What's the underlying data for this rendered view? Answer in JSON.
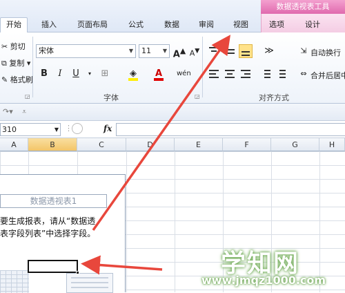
{
  "ribbon": {
    "context_tool_title": "数据透视表工具",
    "tabs": [
      "开始",
      "插入",
      "页面布局",
      "公式",
      "数据",
      "审阅",
      "视图",
      "选项",
      "设计"
    ],
    "active_tab": "开始",
    "clipboard": {
      "cut": "剪切",
      "copy": "复制 ▾",
      "format_painter": "格式刷"
    },
    "font": {
      "name": "宋体",
      "size": "11",
      "group_label": "字体",
      "grow": "A",
      "shrink": "A",
      "bold": "B",
      "italic": "I",
      "underline": "U",
      "phonetic": "wén"
    },
    "alignment": {
      "wrap_text": "自动换行",
      "merge_center": "合并后居中",
      "group_label": "对齐方式"
    }
  },
  "formula_bar": {
    "name_box": "310",
    "fx_label": "fx",
    "value": ""
  },
  "sheet": {
    "columns": [
      "A",
      "B",
      "C",
      "D",
      "E",
      "F",
      "G",
      "H"
    ],
    "selected_column": "B"
  },
  "pivot_placeholder": {
    "title": "数据透视表1",
    "line1": "要生成报表，请从“数据透",
    "line2": "表字段列表”中选择字段。"
  },
  "watermark": {
    "name": "学知网",
    "url": "www.jmqz1000.com"
  },
  "colors": {
    "accent_arrow": "#e8473c",
    "context_tab": "#e06aae",
    "selected_header": "#f3c568"
  }
}
